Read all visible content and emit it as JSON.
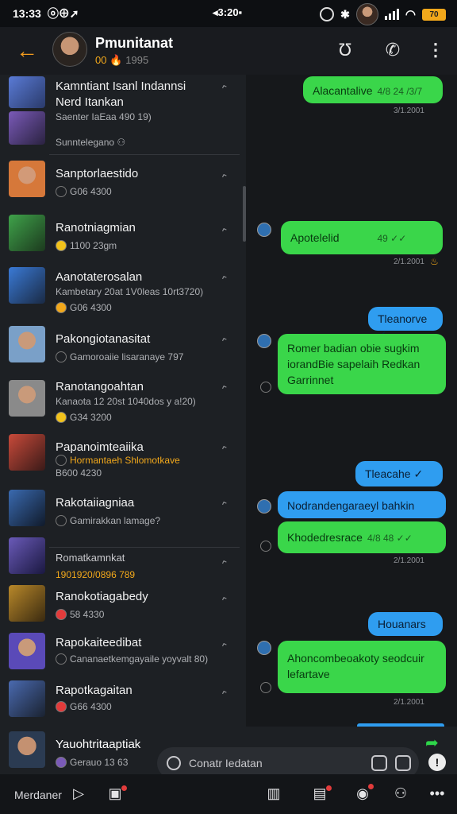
{
  "status_bar": {
    "time": "13:33",
    "indicators": "ⓞ⊕➚",
    "center": "◂3:20▪",
    "battery": "70"
  },
  "header": {
    "title": "Pmunitanat",
    "subtitle": "00 🔥",
    "subtitle_dim": "1995"
  },
  "contacts": [
    {
      "name": "Kamntiant Isanl Indannsi",
      "name2": "Nerd Itankan",
      "sub": "Saenter IaEaa 490 19)",
      "extra": "Sunntelegano ⚇",
      "color": "#5a7bd6"
    },
    {
      "name": "Sanptorlaestido",
      "sub": "G06 4300",
      "color": "#d6783a"
    },
    {
      "name": "Ranotniagmian",
      "sub": "1100 23gm",
      "color": "#3fa24a"
    },
    {
      "name": "Aanotaterosalan",
      "sub": "Kambetary 20at 1V0leas 10rt3720)",
      "extra": "G06 4300",
      "color": "#3a7ad6"
    },
    {
      "name": "Pakongiotanasitat",
      "sub": "Gamoroaiie lisaranaye 797",
      "color": "#7aa0c8"
    },
    {
      "name": "Ranotangoahtan",
      "sub": "Kanaota 12 20st 1040dos y a!20)",
      "extra": "G34 3200",
      "color": "#8a8a8a"
    },
    {
      "name": "Papanoimteaiika",
      "sub": "Hormantaeh Shlomotkave",
      "sub_orange": true,
      "extra": "B600 4230",
      "color": "#c84a3a"
    },
    {
      "name": "Rakotaiiagniaa",
      "sub": "Gamirakkan lamage?",
      "color": "#3a6ab0"
    },
    {
      "name": "Romatkamnkat",
      "sub": "1901920/0896 789",
      "sub_orange": true,
      "color": "#6a5ab8"
    },
    {
      "name": "Ranokotiagabedy",
      "sub": "58 4330",
      "color": "#b8882a"
    },
    {
      "name": "Rapokaiteedibat",
      "sub": "Cananaetkemgayaile yoyvalt 80)",
      "color": "#5a4ab8"
    },
    {
      "name": "Rapotkagaitan",
      "sub": "G66 4300",
      "color": "#4a6ab0"
    }
  ],
  "messages": [
    {
      "kind": "green",
      "text": "Alacantalive",
      "meta": "4/8 24 /3/7",
      "time": "3/1.2001"
    },
    {
      "kind": "green",
      "text": "Apotelelid",
      "meta": "49 ✓✓",
      "time": "2/1.2001"
    },
    {
      "kind": "blue",
      "text": "Tleanorve ✓"
    },
    {
      "kind": "green",
      "text": "Romer badian obie sugkim iorandBie sapelaih Redkan Garrinnet"
    },
    {
      "kind": "blue",
      "text": "Tleacahe ✓"
    },
    {
      "kind": "blue",
      "text": "Nodrandengaraeyl bahkin"
    },
    {
      "kind": "green",
      "text": "Khodedresrace",
      "meta": "4/8 48 ✓✓",
      "time": "2/1.2001"
    },
    {
      "kind": "blue",
      "text": "Houanars"
    },
    {
      "kind": "green",
      "text": "Ahoncombeoakoty seodcuir lefartave",
      "time": "2/1.2001"
    }
  ],
  "composer": {
    "name": "Yauohtritaaptiak",
    "sub": "Gerauo 13 63",
    "placeholder": "Conatr Iedatan"
  },
  "nav": {
    "label": "Merdaner"
  }
}
